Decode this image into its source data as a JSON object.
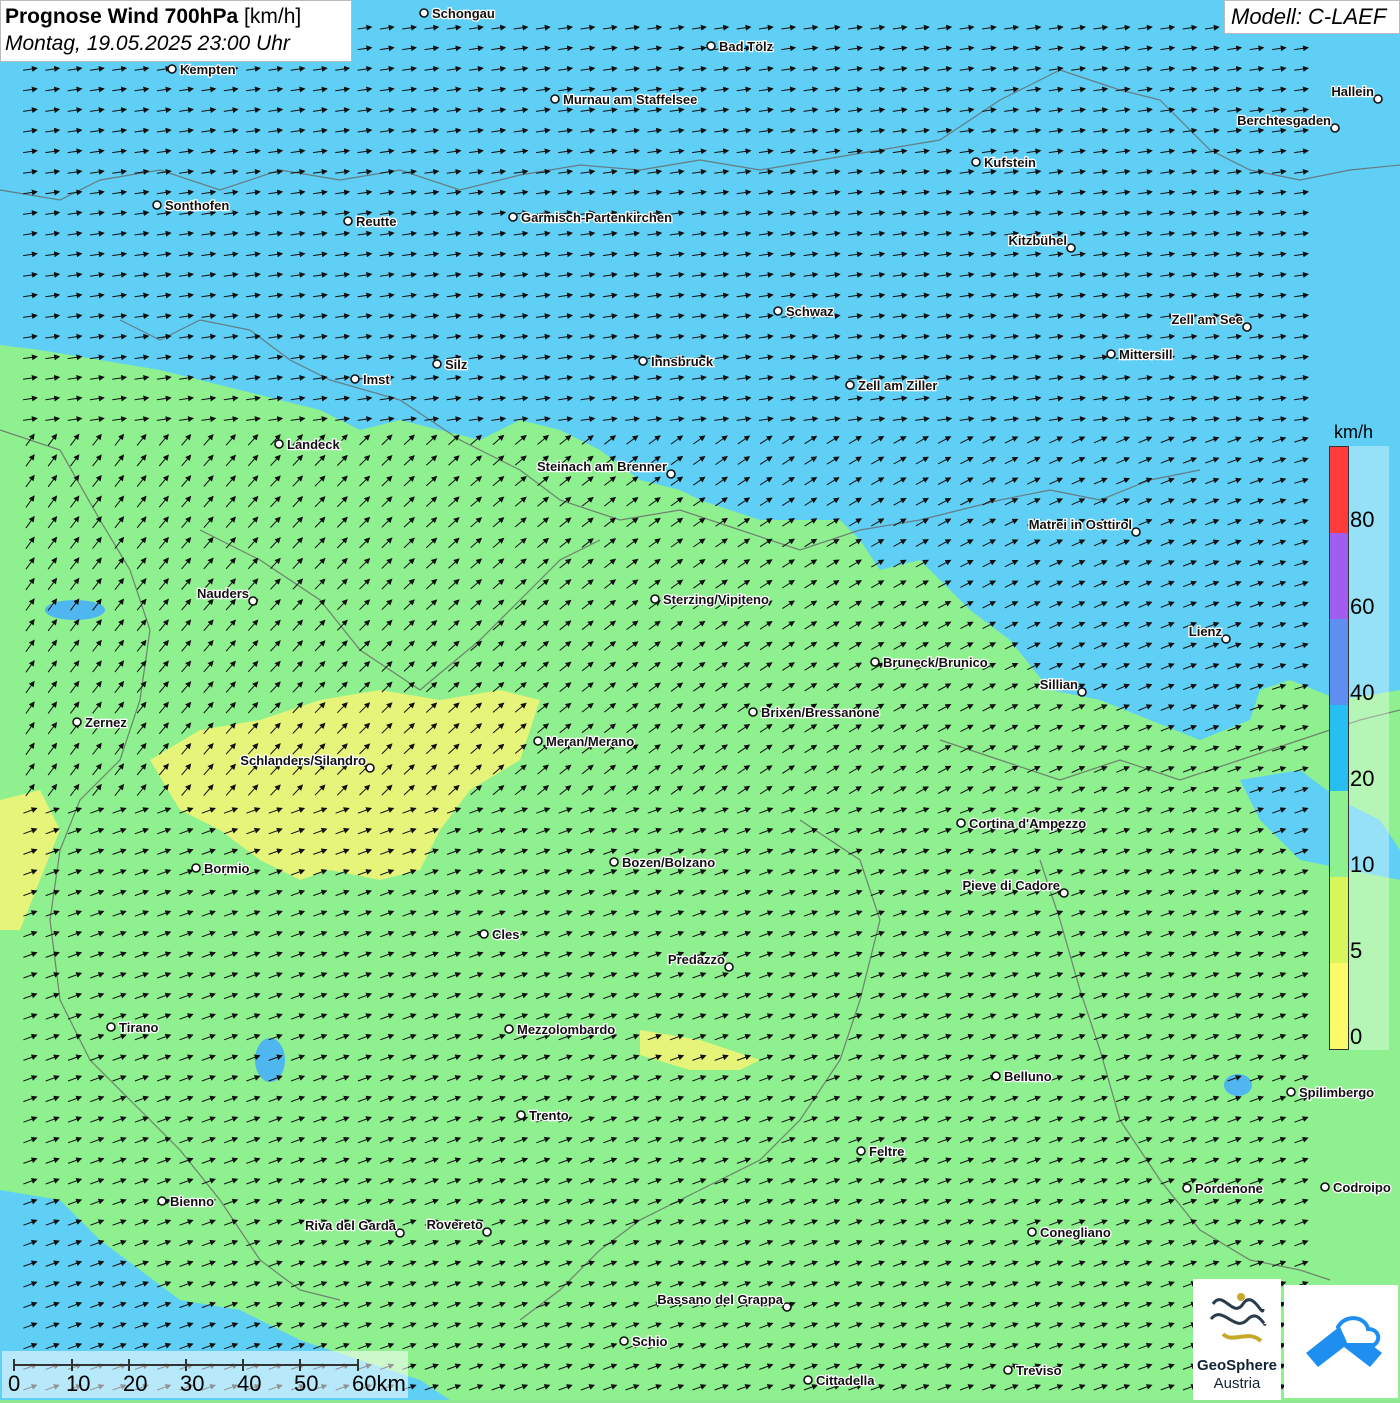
{
  "header": {
    "title_bold": "Prognose Wind 700hPa",
    "title_unit": " [km/h]",
    "date": "Montag, 19.05.2025 23:00 Uhr",
    "model": "Modell: C-LAEF"
  },
  "legend": {
    "unit": "km/h",
    "ticks": [
      "80",
      "60",
      "40",
      "20",
      "10",
      "5",
      "0"
    ],
    "colors": [
      "#ff3b3b",
      "#a05df0",
      "#5e8ff0",
      "#27bff2",
      "#8ef08e",
      "#d8f55c",
      "#fbfb6a"
    ]
  },
  "scale_bar": {
    "labels": [
      "0",
      "10",
      "20",
      "30",
      "40",
      "50",
      "60km"
    ]
  },
  "logos": {
    "geosphere_line1": "GeoSphere",
    "geosphere_line2": "Austria",
    "app_icon": "wind-app-icon"
  },
  "map": {
    "wind_direction": "east / north-east",
    "colors": {
      "calm": "#8ef08e",
      "moderate": "#5fcff5",
      "weak": "#e6f57a"
    },
    "cities": [
      "Schongau",
      "Bad Tölz",
      "Kempten",
      "Murnau am Staffelsee",
      "Hallein",
      "Berchtesgaden",
      "Kufstein",
      "Sonthofen",
      "Reutte",
      "Garmisch-Partenkirchen",
      "Kitzbühel",
      "Schwaz",
      "Zell am See",
      "Mittersill",
      "Innsbruck",
      "Silz",
      "Imst",
      "Zell am Ziller",
      "Landeck",
      "Steinach am Brenner",
      "Matrei in Osttirol",
      "Nauders",
      "Sterzing/Vipiteno",
      "Lienz",
      "Bruneck/Brunico",
      "Sillian",
      "Brixen/Bressanone",
      "Zernez",
      "Meran/Merano",
      "Schlanders/Silandro",
      "Cortina d'Ampezzo",
      "Bozen/Bolzano",
      "Bormio",
      "Pieve di Cadore",
      "Cles",
      "Predazzo",
      "Tirano",
      "Mezzolombardo",
      "Belluno",
      "Spilimbergo",
      "Trento",
      "Feltre",
      "Pordenone",
      "Codroipo",
      "Bienno",
      "Riva del Garda",
      "Rovereto",
      "Conegliano",
      "Bassano del Grappa",
      "Schio",
      "Treviso",
      "Cittadella"
    ]
  }
}
